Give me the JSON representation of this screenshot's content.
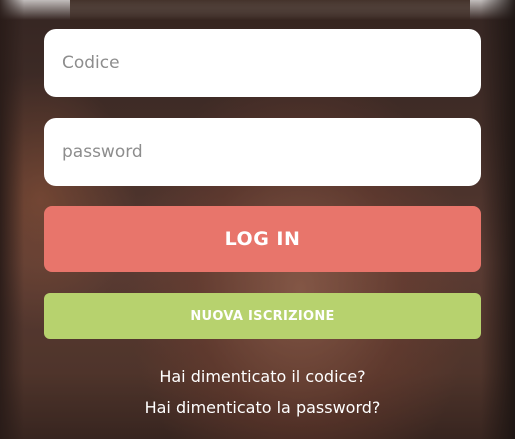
{
  "login_form": {
    "code_placeholder": "Codice",
    "code_value": "",
    "password_placeholder": "password",
    "password_value": "",
    "login_button_label": "LOG IN",
    "register_button_label": "NUOVA ISCRIZIONE"
  },
  "help_links": {
    "forgot_code": "Hai dimenticato il codice?",
    "forgot_password": "Hai dimenticato la password?"
  },
  "colors": {
    "login_button": "#e8756b",
    "register_button": "#b7d26e",
    "input_background": "#ffffff",
    "link_text": "#ffffff"
  }
}
